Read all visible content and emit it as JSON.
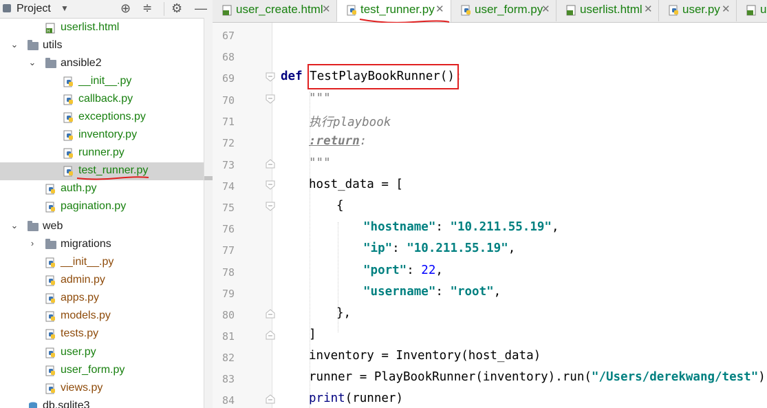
{
  "project_panel": {
    "title": "Project",
    "tree": [
      {
        "label": "userlist.html",
        "type": "html",
        "depth": 2,
        "color": "green"
      },
      {
        "label": "utils",
        "type": "folder",
        "depth": 0,
        "expanded": true,
        "color": "black"
      },
      {
        "label": "ansible2",
        "type": "folder",
        "depth": 1,
        "expanded": true,
        "color": "black"
      },
      {
        "label": "__init__.py",
        "type": "py",
        "depth": 3,
        "color": "green"
      },
      {
        "label": "callback.py",
        "type": "py",
        "depth": 3,
        "color": "green"
      },
      {
        "label": "exceptions.py",
        "type": "py",
        "depth": 3,
        "color": "green"
      },
      {
        "label": "inventory.py",
        "type": "py",
        "depth": 3,
        "color": "green"
      },
      {
        "label": "runner.py",
        "type": "py",
        "depth": 3,
        "color": "green"
      },
      {
        "label": "test_runner.py",
        "type": "py",
        "depth": 3,
        "color": "green",
        "selected": true
      },
      {
        "label": "auth.py",
        "type": "py",
        "depth": 2,
        "color": "green"
      },
      {
        "label": "pagination.py",
        "type": "py",
        "depth": 2,
        "color": "green"
      },
      {
        "label": "web",
        "type": "folder",
        "depth": 0,
        "expanded": true,
        "color": "black"
      },
      {
        "label": "migrations",
        "type": "folder",
        "depth": 1,
        "expanded": false,
        "color": "black"
      },
      {
        "label": "__init__.py",
        "type": "py",
        "depth": 2,
        "color": "brown"
      },
      {
        "label": "admin.py",
        "type": "py",
        "depth": 2,
        "color": "brown"
      },
      {
        "label": "apps.py",
        "type": "py",
        "depth": 2,
        "color": "brown"
      },
      {
        "label": "models.py",
        "type": "py",
        "depth": 2,
        "color": "brown"
      },
      {
        "label": "tests.py",
        "type": "py",
        "depth": 2,
        "color": "brown"
      },
      {
        "label": "user.py",
        "type": "py",
        "depth": 2,
        "color": "green"
      },
      {
        "label": "user_form.py",
        "type": "py",
        "depth": 2,
        "color": "green"
      },
      {
        "label": "views.py",
        "type": "py",
        "depth": 2,
        "color": "brown"
      },
      {
        "label": "db.sqlite3",
        "type": "db",
        "depth": 1,
        "color": "black"
      }
    ]
  },
  "tabs": [
    {
      "label": "user_create.html",
      "type": "html",
      "active": false
    },
    {
      "label": "test_runner.py",
      "type": "py",
      "active": true
    },
    {
      "label": "user_form.py",
      "type": "py",
      "active": false
    },
    {
      "label": "userlist.html",
      "type": "html",
      "active": false
    },
    {
      "label": "user.py",
      "type": "py",
      "active": false
    },
    {
      "label": "us",
      "type": "html",
      "active": false
    }
  ],
  "editor": {
    "line_numbers": [
      "67",
      "68",
      "69",
      "70",
      "71",
      "72",
      "73",
      "74",
      "75",
      "76",
      "77",
      "78",
      "79",
      "80",
      "81",
      "82",
      "83",
      "84"
    ],
    "code": {
      "l69_kw": "def",
      "l69_name": "TestPlayBookRunner():",
      "l70": "\"\"\"",
      "l71": "执行playbook",
      "l72_tag": ":return",
      "l72_colon": ":",
      "l73": "\"\"\"",
      "l74": "host_data = [",
      "l75": "{",
      "l76_key": "\"hostname\"",
      "l76_sep": ": ",
      "l76_val": "\"10.211.55.19\"",
      "l76_end": ",",
      "l77_key": "\"ip\"",
      "l77_sep": ": ",
      "l77_val": "\"10.211.55.19\"",
      "l77_end": ",",
      "l78_key": "\"port\"",
      "l78_sep": ": ",
      "l78_val": "22",
      "l78_end": ",",
      "l79_key": "\"username\"",
      "l79_sep": ": ",
      "l79_val": "\"root\"",
      "l79_end": ",",
      "l80": "},",
      "l81": "]",
      "l82": "inventory = Inventory(host_data)",
      "l83_pre": "runner = PlayBookRunner(inventory).run(",
      "l83_str": "\"/Users/derekwang/test\"",
      "l83_end": ")",
      "l84_kw": "print",
      "l84_rest": "(runner)"
    }
  },
  "colors": {
    "annotation_red": "#e02020",
    "vcs_green": "#18800f",
    "vcs_brown": "#8e4b0a",
    "keyword_navy": "#000080",
    "string_teal": "#008080",
    "number_blue": "#0000ff"
  }
}
